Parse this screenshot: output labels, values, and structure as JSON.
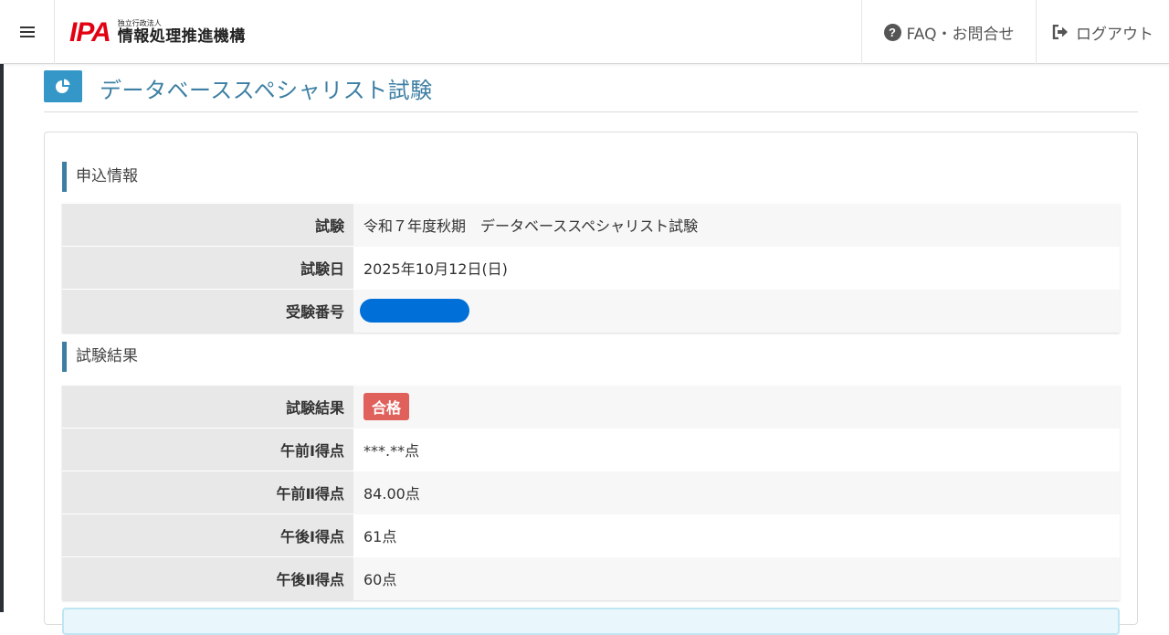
{
  "header": {
    "logo_mark": "IPA",
    "logo_sub": "独立行政法人",
    "logo_main": "情報処理推進機構",
    "faq_label": "FAQ・お問合せ",
    "logout_label": "ログアウト"
  },
  "page": {
    "title": "データベーススペシャリスト試験"
  },
  "application": {
    "section_title": "申込情報",
    "rows": [
      {
        "label": "試験",
        "value": "令和７年度秋期　データベーススペシャリスト試験"
      },
      {
        "label": "試験日",
        "value": "2025年10月12日(日)"
      },
      {
        "label": "受験番号",
        "value": ""
      }
    ]
  },
  "result": {
    "section_title": "試験結果",
    "status_label": "試験結果",
    "status_value": "合格",
    "rows": [
      {
        "label": "午前Ⅰ得点",
        "value": "***.**点"
      },
      {
        "label": "午前Ⅱ得点",
        "value": "84.00点"
      },
      {
        "label": "午後Ⅰ得点",
        "value": "61点"
      },
      {
        "label": "午後Ⅱ得点",
        "value": "60点"
      }
    ]
  },
  "colors": {
    "accent": "#3d7fa3",
    "title_icon_bg": "#3497c8",
    "pass_badge": "#e0605c",
    "logo_red": "#e30012",
    "redaction": "#0070d8"
  }
}
